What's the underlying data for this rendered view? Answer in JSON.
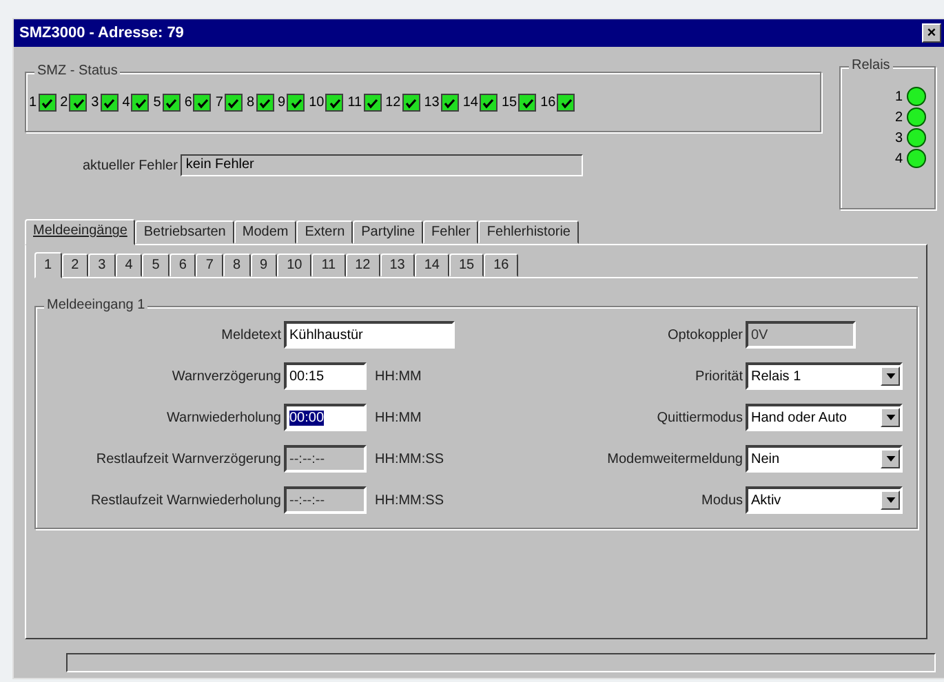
{
  "window": {
    "title": "SMZ3000 - Adresse: 79",
    "close": "×"
  },
  "status": {
    "title": "SMZ - Status",
    "inputs": [
      {
        "label": "1",
        "checked": true
      },
      {
        "label": "2",
        "checked": true
      },
      {
        "label": "3",
        "checked": true
      },
      {
        "label": "4",
        "checked": true
      },
      {
        "label": "5",
        "checked": true
      },
      {
        "label": "6",
        "checked": true
      },
      {
        "label": "7",
        "checked": true
      },
      {
        "label": "8",
        "checked": true
      },
      {
        "label": "9",
        "checked": true
      },
      {
        "label": "10",
        "checked": true
      },
      {
        "label": "11",
        "checked": true
      },
      {
        "label": "12",
        "checked": true
      },
      {
        "label": "13",
        "checked": true
      },
      {
        "label": "14",
        "checked": true
      },
      {
        "label": "15",
        "checked": true
      },
      {
        "label": "16",
        "checked": true
      }
    ]
  },
  "relais": {
    "title": "Relais",
    "items": [
      {
        "label": "1",
        "on": true
      },
      {
        "label": "2",
        "on": true
      },
      {
        "label": "3",
        "on": true
      },
      {
        "label": "4",
        "on": true
      }
    ]
  },
  "error": {
    "label": "aktueller Fehler",
    "value": "kein Fehler"
  },
  "tabs": [
    {
      "label": "Meldeeingänge",
      "selected": true
    },
    {
      "label": "Betriebsarten",
      "selected": false
    },
    {
      "label": "Modem",
      "selected": false
    },
    {
      "label": "Extern",
      "selected": false
    },
    {
      "label": "Partyline",
      "selected": false
    },
    {
      "label": "Fehler",
      "selected": false
    },
    {
      "label": "Fehlerhistorie",
      "selected": false
    }
  ],
  "subtabs": [
    {
      "label": "1",
      "selected": true
    },
    {
      "label": "2",
      "selected": false
    },
    {
      "label": "3",
      "selected": false
    },
    {
      "label": "4",
      "selected": false
    },
    {
      "label": "5",
      "selected": false
    },
    {
      "label": "6",
      "selected": false
    },
    {
      "label": "7",
      "selected": false
    },
    {
      "label": "8",
      "selected": false
    },
    {
      "label": "9",
      "selected": false
    },
    {
      "label": "10",
      "selected": false
    },
    {
      "label": "11",
      "selected": false
    },
    {
      "label": "12",
      "selected": false
    },
    {
      "label": "13",
      "selected": false
    },
    {
      "label": "14",
      "selected": false
    },
    {
      "label": "15",
      "selected": false
    },
    {
      "label": "16",
      "selected": false
    }
  ],
  "group": {
    "title": "Meldeeingang 1",
    "left": [
      {
        "kind": "text",
        "label": "Meldetext",
        "value": "Kühlhaustür",
        "wide": true,
        "disabled": false,
        "highlighted": false
      },
      {
        "kind": "text",
        "label": "Warnverzögerung",
        "value": "00:15",
        "unit": "HH:MM",
        "wide": false,
        "disabled": false,
        "highlighted": false
      },
      {
        "kind": "text",
        "label": "Warnwiederholung",
        "value": "00:00",
        "unit": "HH:MM",
        "wide": false,
        "disabled": false,
        "highlighted": true
      },
      {
        "kind": "text",
        "label": "Restlaufzeit Warnverzögerung",
        "value": "--:--:--",
        "unit": "HH:MM:SS",
        "wide": false,
        "disabled": true,
        "highlighted": false
      },
      {
        "kind": "text",
        "label": "Restlaufzeit Warnwiederholung",
        "value": "--:--:--",
        "unit": "HH:MM:SS",
        "wide": false,
        "disabled": true,
        "highlighted": false
      }
    ],
    "right": [
      {
        "kind": "text",
        "label": "Optokoppler",
        "value": "0V",
        "disabled": true,
        "highlighted": false
      },
      {
        "kind": "combo",
        "label": "Priorität",
        "value": "Relais 1"
      },
      {
        "kind": "combo",
        "label": "Quittiermodus",
        "value": "Hand oder Auto"
      },
      {
        "kind": "combo",
        "label": "Modemweitermeldung",
        "value": "Nein"
      },
      {
        "kind": "combo",
        "label": "Modus",
        "value": "Aktiv"
      }
    ]
  }
}
